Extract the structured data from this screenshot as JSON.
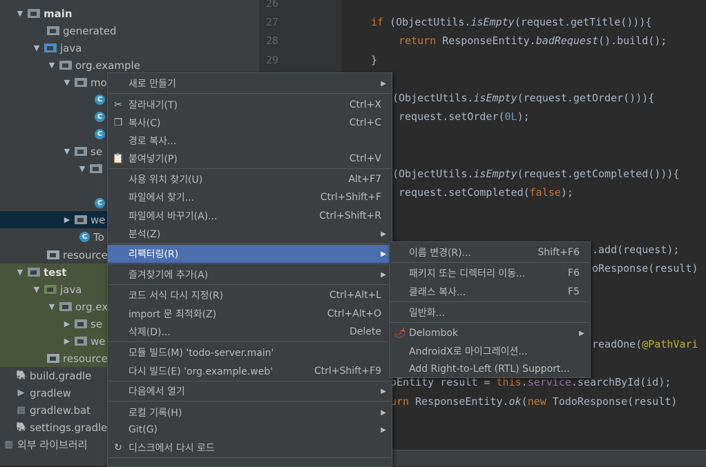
{
  "tree": {
    "items": [
      {
        "label": "main"
      },
      {
        "label": "generated"
      },
      {
        "label": "java"
      },
      {
        "label": "org.example"
      },
      {
        "label": "mo"
      },
      {
        "label": "se"
      },
      {
        "label": "we"
      },
      {
        "label": "To"
      },
      {
        "label": "resources"
      },
      {
        "label": "test"
      },
      {
        "label": "java"
      },
      {
        "label": "org.ex"
      },
      {
        "label": "se"
      },
      {
        "label": "we"
      },
      {
        "label": "resources"
      },
      {
        "label": "build.gradle"
      },
      {
        "label": "gradlew"
      },
      {
        "label": "gradlew.bat"
      },
      {
        "label": "settings.gradle"
      },
      {
        "label": "외부 라이브러리"
      }
    ]
  },
  "gutter": {
    "lines": [
      "26",
      "27",
      "28",
      "29"
    ]
  },
  "code": {
    "l1_kw": "if",
    "l1_a": " (ObjectUtils.",
    "l1_b": "isEmpty",
    "l1_c": "(request.getTitle())){",
    "l2_kw": "return",
    "l2_a": " ResponseEntity.",
    "l2_b": "badRequest",
    "l2_c": "().build();",
    "l3": "}",
    "l4_a": "(ObjectUtils.",
    "l4_b": "isEmpty",
    "l4_c": "(request.getOrder())){",
    "l5_a": "request.setOrder(",
    "l5_b": "0L",
    "l5_c": ");",
    "l6_a": "(ObjectUtils.",
    "l6_b": "isEmpty",
    "l6_c": "(request.getCompleted())){",
    "l7_a": "request.setCompleted(",
    "l7_b": "false",
    "l7_c": ");",
    "l8": ".add(request);",
    "l9": "oResponse(result)",
    "l10_a": "readOne(",
    "l10_b": "@PathVari",
    "l11_a": "oEntity result = ",
    "l11_b": "this",
    "l11_c": ".",
    "l11_d": "service",
    "l11_e": ".searchById(id);",
    "l12_a": "urn",
    "l12_b": " ResponseEntity.",
    "l12_c": "ok",
    "l12_d": "(",
    "l12_e": "new",
    "l12_f": " TodoResponse(result)"
  },
  "context_menu": {
    "items": [
      {
        "label": "새로 만들기",
        "shortcut": ""
      },
      {
        "label": "잘라내기(T)",
        "shortcut": "Ctrl+X"
      },
      {
        "label": "복사(C)",
        "shortcut": "Ctrl+C"
      },
      {
        "label": "경로 복사...",
        "shortcut": ""
      },
      {
        "label": "붙여넣기(P)",
        "shortcut": "Ctrl+V"
      },
      {
        "label": "사용 위치 찾기(U)",
        "shortcut": "Alt+F7"
      },
      {
        "label": "파일에서 찾기...",
        "shortcut": "Ctrl+Shift+F"
      },
      {
        "label": "파일에서 바꾸기(A)...",
        "shortcut": "Ctrl+Shift+R"
      },
      {
        "label": "분석(Z)",
        "shortcut": ""
      },
      {
        "label": "리팩터링(R)",
        "shortcut": ""
      },
      {
        "label": "즐겨찾기에 추가(A)",
        "shortcut": ""
      },
      {
        "label": "코드 서식 다시 지정(R)",
        "shortcut": "Ctrl+Alt+L"
      },
      {
        "label": "import 문 최적화(Z)",
        "shortcut": "Ctrl+Alt+O"
      },
      {
        "label": "삭제(D)...",
        "shortcut": "Delete"
      },
      {
        "label": "모듈 빌드(M) 'todo-server.main'",
        "shortcut": ""
      },
      {
        "label": "다시 빌드(E) 'org.example.web'",
        "shortcut": "Ctrl+Shift+F9"
      },
      {
        "label": "다음에서 열기",
        "shortcut": ""
      },
      {
        "label": "로컬 기록(H)",
        "shortcut": ""
      },
      {
        "label": "Git(G)",
        "shortcut": ""
      },
      {
        "label": "디스크에서 다시 로드",
        "shortcut": ""
      }
    ]
  },
  "refactor_menu": {
    "items": [
      {
        "label": "이름 변경(R)...",
        "shortcut": "Shift+F6"
      },
      {
        "label": "패키지 또는 디렉터리 이동...",
        "shortcut": "F6"
      },
      {
        "label": "클래스 복사...",
        "shortcut": "F5"
      },
      {
        "label": "일반화...",
        "shortcut": ""
      },
      {
        "label": "Delombok",
        "shortcut": ""
      },
      {
        "label": "AndroidX로 마이그레이션...",
        "shortcut": ""
      },
      {
        "label": "Add Right-to-Left (RTL) Support...",
        "shortcut": ""
      }
    ]
  },
  "colors": {
    "highlight": "#4b6eaf",
    "menu_bg": "#3c3f41",
    "editor_bg": "#2b2b2b"
  }
}
